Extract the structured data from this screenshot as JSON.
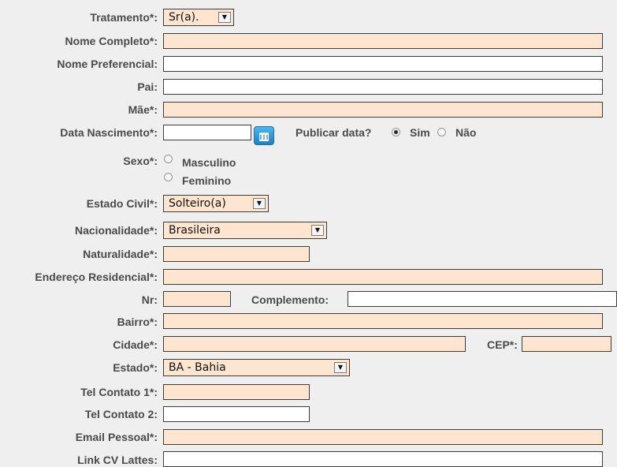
{
  "form": {
    "tratamento": {
      "label": "Tratamento*:",
      "value": "Sr(a)."
    },
    "nome_completo": {
      "label": "Nome Completo*:",
      "value": ""
    },
    "nome_preferencial": {
      "label": "Nome Preferencial:",
      "value": ""
    },
    "pai": {
      "label": "Pai:",
      "value": ""
    },
    "mae": {
      "label": "Mãe*:",
      "value": ""
    },
    "data_nascimento": {
      "label": "Data Nascimento*:",
      "value": ""
    },
    "publicar_data": {
      "label": "Publicar data?",
      "options": [
        "Sim",
        "Não"
      ],
      "selected": "Sim"
    },
    "sexo": {
      "label": "Sexo*:",
      "options": [
        "Masculino",
        "Feminino"
      ],
      "selected": ""
    },
    "estado_civil": {
      "label": "Estado Civil*:",
      "value": "Solteiro(a)"
    },
    "nacionalidade": {
      "label": "Nacionalidade*:",
      "value": "Brasileira"
    },
    "naturalidade": {
      "label": "Naturalidade*:",
      "value": ""
    },
    "endereco_residencial": {
      "label": "Endereço Residencial*:",
      "value": ""
    },
    "nr": {
      "label": "Nr:",
      "value": ""
    },
    "complemento": {
      "label": "Complemento:",
      "value": ""
    },
    "bairro": {
      "label": "Bairro*:",
      "value": ""
    },
    "cidade": {
      "label": "Cidade*:",
      "value": ""
    },
    "cep": {
      "label": "CEP*:",
      "value": ""
    },
    "estado": {
      "label": "Estado*:",
      "value": "BA - Bahia"
    },
    "tel_contato_1": {
      "label": "Tel Contato 1*:",
      "value": ""
    },
    "tel_contato_2": {
      "label": "Tel Contato 2:",
      "value": ""
    },
    "email_pessoal": {
      "label": "Email Pessoal*:",
      "value": ""
    },
    "link_cv_lattes": {
      "label": "Link CV Lattes:",
      "value": ""
    }
  },
  "colors": {
    "required_field_bg": "#fde5cf",
    "optional_field_bg": "#ffffff",
    "page_bg": "#efefef",
    "calendar_button": "#2a8fd6"
  },
  "icons": {
    "calendar_button": "calendar-icon",
    "select_arrow": "dropdown-arrow-icon"
  }
}
